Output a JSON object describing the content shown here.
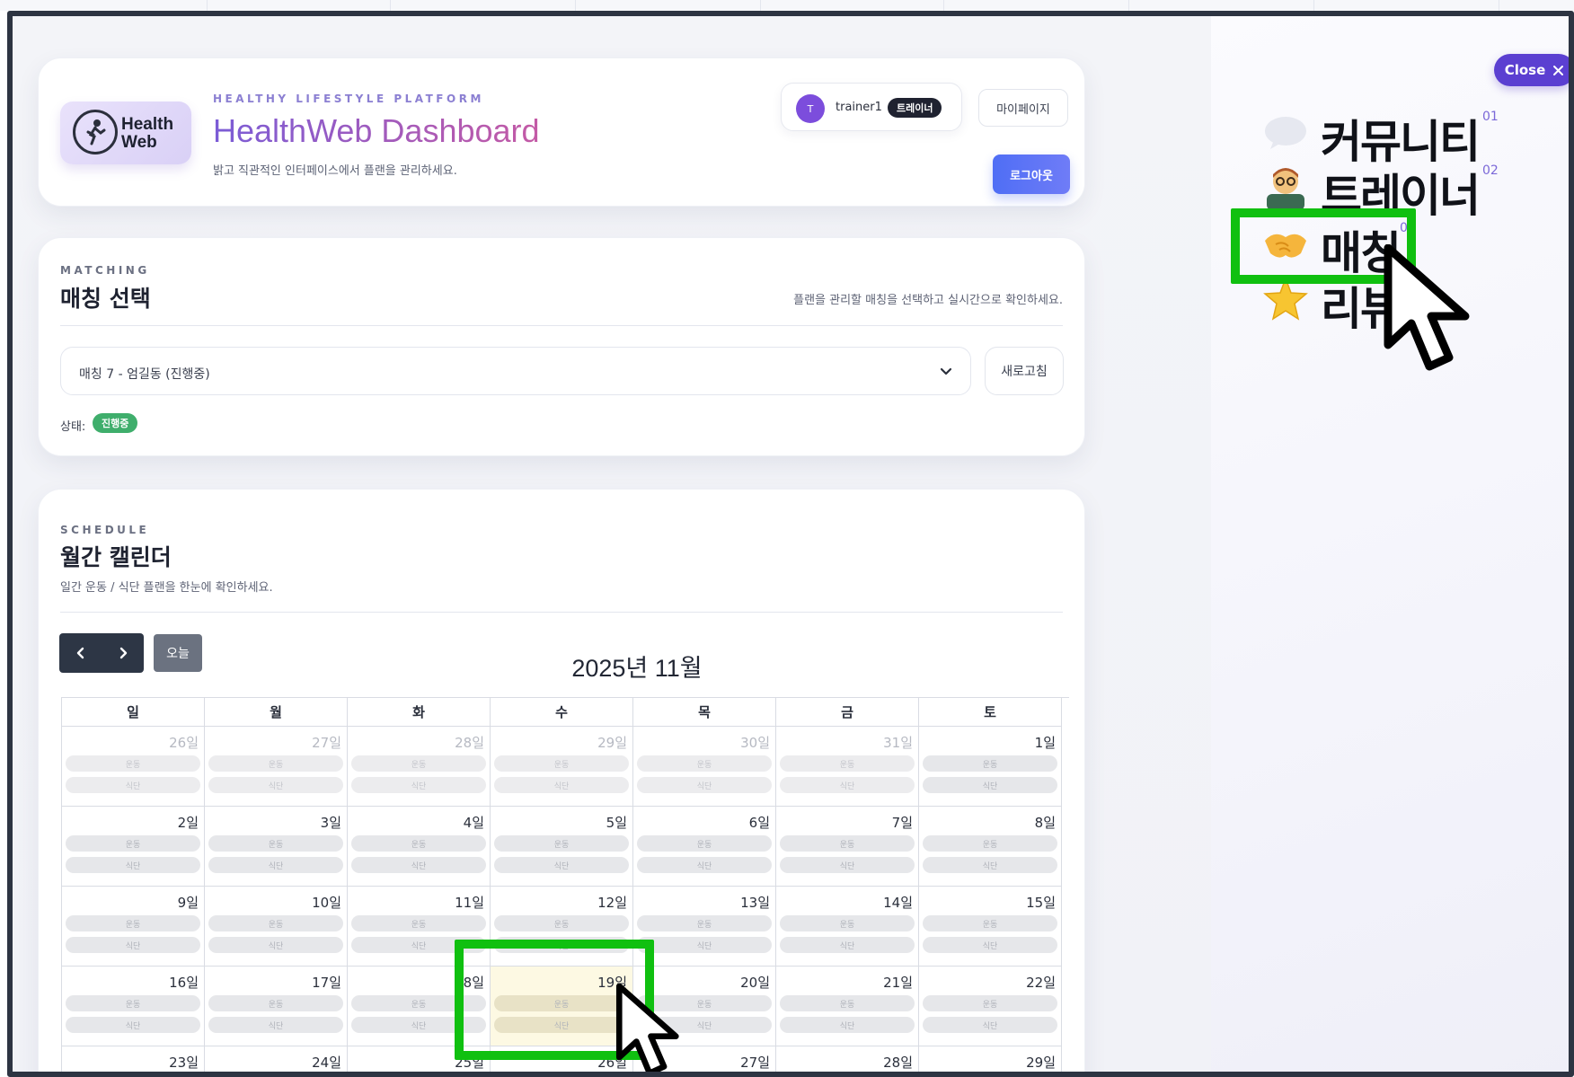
{
  "header": {
    "logo_line1": "Health",
    "logo_line2": "Web",
    "eyebrow": "HEALTHY LIFESTYLE PLATFORM",
    "title": "HealthWeb Dashboard",
    "subtitle": "밝고 직관적인 인터페이스에서 플랜을 관리하세요.",
    "user_initial": "T",
    "user_name": "trainer1",
    "user_role": "트레이너",
    "mypage_label": "마이페이지",
    "logout_label": "로그아웃"
  },
  "matching": {
    "eyebrow": "MATCHING",
    "title": "매칭 선택",
    "hint": "플랜을 관리할 매칭을 선택하고 실시간으로 확인하세요.",
    "selected": "매칭 7 - 엄길동 (진행중)",
    "refresh_label": "새로고침",
    "status_label": "상태:",
    "status_value": "진행중"
  },
  "schedule": {
    "eyebrow": "SCHEDULE",
    "title": "월간 캘린더",
    "subtitle": "일간 운동 / 식단 플랜을 한눈에 확인하세요.",
    "today_label": "오늘",
    "month_label": "2025년 11월",
    "weekdays": [
      "일",
      "월",
      "화",
      "수",
      "목",
      "금",
      "토"
    ],
    "exercise_label": "운동",
    "diet_label": "식단",
    "weeks": [
      [
        {
          "d": "26일",
          "m": true
        },
        {
          "d": "27일",
          "m": true
        },
        {
          "d": "28일",
          "m": true
        },
        {
          "d": "29일",
          "m": true
        },
        {
          "d": "30일",
          "m": true
        },
        {
          "d": "31일",
          "m": true
        },
        {
          "d": "1일"
        }
      ],
      [
        {
          "d": "2일"
        },
        {
          "d": "3일"
        },
        {
          "d": "4일"
        },
        {
          "d": "5일"
        },
        {
          "d": "6일"
        },
        {
          "d": "7일"
        },
        {
          "d": "8일"
        }
      ],
      [
        {
          "d": "9일"
        },
        {
          "d": "10일"
        },
        {
          "d": "11일"
        },
        {
          "d": "12일"
        },
        {
          "d": "13일"
        },
        {
          "d": "14일"
        },
        {
          "d": "15일"
        }
      ],
      [
        {
          "d": "16일"
        },
        {
          "d": "17일"
        },
        {
          "d": "18일"
        },
        {
          "d": "19일",
          "t": true
        },
        {
          "d": "20일"
        },
        {
          "d": "21일"
        },
        {
          "d": "22일"
        }
      ],
      [
        {
          "d": "23일"
        },
        {
          "d": "24일"
        },
        {
          "d": "25일"
        },
        {
          "d": "26일"
        },
        {
          "d": "27일"
        },
        {
          "d": "28일"
        },
        {
          "d": "29일"
        }
      ]
    ]
  },
  "panel": {
    "close_label": "Close",
    "menu": [
      {
        "label": "커뮤니티",
        "num": "01",
        "icon": "speech-bubble-icon"
      },
      {
        "label": "트레이너",
        "num": "02",
        "icon": "trainer-icon"
      },
      {
        "label": "매칭",
        "num": "03",
        "icon": "handshake-icon"
      },
      {
        "label": "리뷰",
        "num": "04",
        "icon": "star-icon"
      }
    ]
  },
  "colors": {
    "accent": "#5b3fd1",
    "highlight": "#10c010",
    "status_green": "#3fae6c",
    "frame": "#2d3442"
  }
}
